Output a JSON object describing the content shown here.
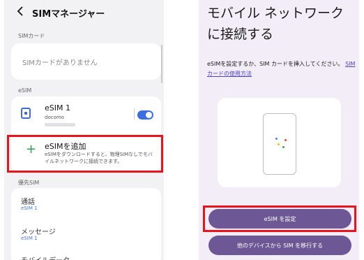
{
  "left": {
    "back_icon": "chevron-left-icon",
    "title": "SIMマネージャー",
    "sim_section": "SIMカード",
    "no_sim": "SIMカードがありません",
    "esim_section": "eSIM",
    "esim1_name": "eSIM 1",
    "esim1_carrier": "docomo",
    "esim1_enabled": true,
    "add_title": "eSIMを追加",
    "add_desc": "eSIMをダウンロードすると、物理SIMなしでモバイルネットワークに接続できます。",
    "priority_section": "優先SIM",
    "call_label": "通話",
    "call_value": "eSIM 1",
    "message_label": "メッセージ",
    "message_value": "eSIM 1",
    "cut_label": "モバイルデータ"
  },
  "right": {
    "title": "モバイル ネットワークに接続する",
    "desc": "eSIMを設定するか、SIM カードを挿入してください。",
    "link": "SIM カードの使用方法",
    "setup_button": "eSIM を設定",
    "transfer_button": "他のデバイスから SIM を移行する"
  },
  "colors": {
    "accent_blue": "#3b6fe0",
    "add_green": "#2f9d51",
    "highlight_red": "#e8141c",
    "button_purple": "#6d5794"
  }
}
